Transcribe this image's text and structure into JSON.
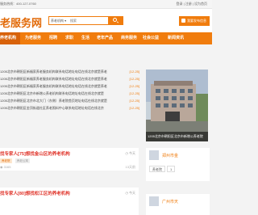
{
  "topbar": {
    "hotline": "服务热线：400-127-0760",
    "right": "登录 | 注册 | 设为首页"
  },
  "header": {
    "logo": "老服务网",
    "search_select": "养老机构 ▾",
    "search_placeholder": "搜索",
    "publish": "我要发布信息"
  },
  "nav": {
    "items": [
      "养老机构",
      "为老服务",
      "招聘",
      "求职",
      "生活",
      "老年产品",
      "商务服务",
      "社会公益",
      "新闻资讯"
    ]
  },
  "news": [
    {
      "text": "1205北京市朝阳区新福家养老服务机构联系电话地址电话在线北京就是养老",
      "date": "[12-25]"
    },
    {
      "text": "1205北京市朝阳区新福家养老服务机构联系电话地址电话在线北京就是养老",
      "date": "[12-25]"
    },
    {
      "text": "1205北京市朝阳区新福家养老服务机构联系电话地址电话在线北京就是养老",
      "date": "[12-25]"
    },
    {
      "text": "1205北京市朝阳区北京市新增公养老机构联系电话地址电话在线北京就是",
      "date": "[12-25]"
    },
    {
      "text": "1205北京市朝阳区北京市北大门（东侧）养老院首页地址电话在线北京就是",
      "date": "[12-25]"
    },
    {
      "text": "1205北京市朝阳区金顶街道社区养老照料中心联系电话地址电话在线北京",
      "date": "[12-25]"
    }
  ],
  "photo": {
    "caption": "1205北京市朝阳区北京市新增公养老院"
  },
  "cards": [
    {
      "title": "找专家人[75]想找金山区的养老机构",
      "time": "今天",
      "tags": [
        "养老院",
        "养老公寓"
      ],
      "views": "3165",
      "meta": "13天前"
    },
    {
      "title": "找专家人[80]想找松江区的养老机构",
      "time": "今天"
    }
  ],
  "side": {
    "name": "郑州市金",
    "tags": [
      "养老院",
      "1"
    ],
    "name2": "广州市天"
  },
  "colors": {
    "accent": "#f07c0d",
    "title_red": "#e0352b"
  }
}
